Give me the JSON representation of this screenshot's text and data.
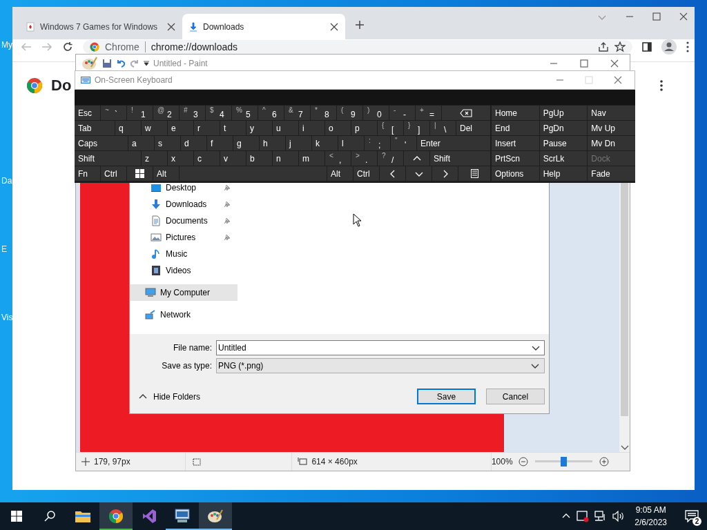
{
  "desktop": {
    "icon_labels": [
      "My",
      "Da",
      "E",
      "Vis"
    ]
  },
  "browser": {
    "tabs": [
      {
        "title": "Windows 7 Games for Windows",
        "selected": false
      },
      {
        "title": "Downloads",
        "selected": true
      }
    ],
    "chip": "Chrome",
    "url": "chrome://downloads",
    "heading": "Do"
  },
  "paint": {
    "title": "Untitled - Paint",
    "position": "179, 97px",
    "size": "614 × 460px",
    "zoom": "100%",
    "zoom_slider": {
      "level": 0.5
    }
  },
  "keyboard": {
    "title": "On-Screen Keyboard",
    "rows": [
      [
        {
          "kind": "text",
          "label": "Esc"
        },
        {
          "kind": "pair",
          "shift": "~",
          "label": "`"
        },
        {
          "kind": "pair",
          "shift": "!",
          "label": "1"
        },
        {
          "kind": "pair",
          "shift": "@",
          "label": "2"
        },
        {
          "kind": "pair",
          "shift": "#",
          "label": "3"
        },
        {
          "kind": "pair",
          "shift": "$",
          "label": "4"
        },
        {
          "kind": "pair",
          "shift": "%",
          "label": "5"
        },
        {
          "kind": "pair",
          "shift": "^",
          "label": "6"
        },
        {
          "kind": "pair",
          "shift": "&",
          "label": "7"
        },
        {
          "kind": "pair",
          "shift": "*",
          "label": "8"
        },
        {
          "kind": "pair",
          "shift": "(",
          "label": "9"
        },
        {
          "kind": "pair",
          "shift": ")",
          "label": "0"
        },
        {
          "kind": "pair",
          "shift": "-",
          "label": "-"
        },
        {
          "kind": "pair",
          "shift": "+",
          "label": "="
        },
        {
          "kind": "backspace"
        }
      ],
      [
        {
          "kind": "text",
          "label": "Tab"
        },
        {
          "kind": "text",
          "label": "q"
        },
        {
          "kind": "text",
          "label": "w"
        },
        {
          "kind": "text",
          "label": "e"
        },
        {
          "kind": "text",
          "label": "r"
        },
        {
          "kind": "text",
          "label": "t"
        },
        {
          "kind": "text",
          "label": "y"
        },
        {
          "kind": "text",
          "label": "u"
        },
        {
          "kind": "text",
          "label": "i"
        },
        {
          "kind": "text",
          "label": "o"
        },
        {
          "kind": "text",
          "label": "p"
        },
        {
          "kind": "pair",
          "shift": "{",
          "label": "["
        },
        {
          "kind": "pair",
          "shift": "}",
          "label": "]"
        },
        {
          "kind": "pair",
          "shift": "|",
          "label": "\\"
        },
        {
          "kind": "text",
          "label": "Del"
        }
      ],
      [
        {
          "kind": "text",
          "label": "Caps"
        },
        {
          "kind": "text",
          "label": "a"
        },
        {
          "kind": "text",
          "label": "s"
        },
        {
          "kind": "text",
          "label": "d"
        },
        {
          "kind": "text",
          "label": "f"
        },
        {
          "kind": "text",
          "label": "g"
        },
        {
          "kind": "text",
          "label": "h"
        },
        {
          "kind": "text",
          "label": "j"
        },
        {
          "kind": "text",
          "label": "k"
        },
        {
          "kind": "text",
          "label": "l"
        },
        {
          "kind": "pair",
          "shift": ":",
          "label": ";"
        },
        {
          "kind": "pair",
          "shift": "\"",
          "label": "'"
        },
        {
          "kind": "text",
          "label": "Enter"
        }
      ],
      [
        {
          "kind": "text",
          "label": "Shift"
        },
        {
          "kind": "text",
          "label": "z"
        },
        {
          "kind": "text",
          "label": "x"
        },
        {
          "kind": "text",
          "label": "c"
        },
        {
          "kind": "text",
          "label": "v"
        },
        {
          "kind": "text",
          "label": "b"
        },
        {
          "kind": "text",
          "label": "n"
        },
        {
          "kind": "text",
          "label": "m"
        },
        {
          "kind": "pair",
          "shift": "<",
          "label": ","
        },
        {
          "kind": "pair",
          "shift": ">",
          "label": "."
        },
        {
          "kind": "pair",
          "shift": "?",
          "label": "/"
        },
        {
          "kind": "up"
        },
        {
          "kind": "text",
          "label": "Shift"
        }
      ],
      [
        {
          "kind": "text",
          "label": "Fn"
        },
        {
          "kind": "text",
          "label": "Ctrl"
        },
        {
          "kind": "windows"
        },
        {
          "kind": "text",
          "label": "Alt"
        },
        {
          "kind": "space"
        },
        {
          "kind": "text",
          "label": "Alt"
        },
        {
          "kind": "text",
          "label": "Ctrl"
        },
        {
          "kind": "left"
        },
        {
          "kind": "down"
        },
        {
          "kind": "right"
        },
        {
          "kind": "menu"
        }
      ]
    ],
    "nav_keys": [
      {
        "label": "Home",
        "disabled": false
      },
      {
        "label": "PgUp",
        "disabled": false
      },
      {
        "label": "Nav",
        "disabled": false
      },
      {
        "label": "End",
        "disabled": false
      },
      {
        "label": "PgDn",
        "disabled": false
      },
      {
        "label": "Mv Up",
        "disabled": false
      },
      {
        "label": "Insert",
        "disabled": false
      },
      {
        "label": "Pause",
        "disabled": false
      },
      {
        "label": "Mv Dn",
        "disabled": false
      },
      {
        "label": "PrtScn",
        "disabled": false
      },
      {
        "label": "ScrLk",
        "disabled": false
      },
      {
        "label": "Dock",
        "disabled": true
      },
      {
        "label": "Options",
        "disabled": false
      },
      {
        "label": "Help",
        "disabled": false
      },
      {
        "label": "Fade",
        "disabled": false
      }
    ]
  },
  "save_dialog": {
    "quick_access": [
      {
        "kind": "desktop",
        "label": "Desktop",
        "pinned": true
      },
      {
        "kind": "downloads",
        "label": "Downloads",
        "pinned": true
      },
      {
        "kind": "documents",
        "label": "Documents",
        "pinned": true
      },
      {
        "kind": "pictures",
        "label": "Pictures",
        "pinned": true
      },
      {
        "kind": "music",
        "label": "Music",
        "pinned": false
      },
      {
        "kind": "videos",
        "label": "Videos",
        "pinned": false
      }
    ],
    "locations": [
      {
        "kind": "computer",
        "label": "My Computer",
        "selected": true
      },
      {
        "kind": "network",
        "label": "Network",
        "selected": false
      }
    ],
    "file_name_label": "File name:",
    "file_name": "Untitled",
    "type_label": "Save as type:",
    "type": "PNG (*.png)",
    "hide_folders": "Hide Folders",
    "buttons": [
      "Save",
      "Cancel"
    ]
  },
  "taskbar": {
    "apps": [
      {
        "kind": "explorer",
        "running": false,
        "highlighted": false
      },
      {
        "kind": "chrome",
        "running": true,
        "highlighted": true,
        "color": "#4caf50"
      },
      {
        "kind": "studio",
        "running": false,
        "highlighted": false
      },
      {
        "kind": "remote",
        "running": true,
        "highlighted": false,
        "color": "#76b9ed"
      },
      {
        "kind": "paint",
        "running": true,
        "highlighted": true,
        "color": "#76b9ed"
      }
    ],
    "time": "9:05 AM",
    "date": "2/6/2023",
    "notification_count": "2"
  }
}
